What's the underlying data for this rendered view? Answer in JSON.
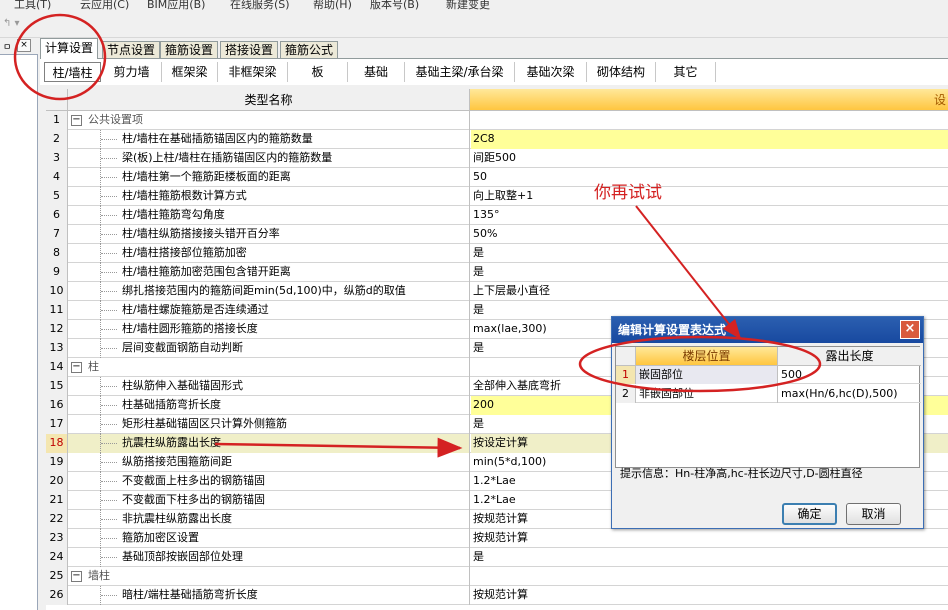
{
  "menu": {
    "items": [
      "工具(T)",
      "云应用(C)",
      "BIM应用(B)",
      "在线服务(S)",
      "帮助(H)",
      "版本号(B)",
      "新建变更"
    ]
  },
  "left_panel": {
    "pin": "📌",
    "close": "×"
  },
  "tabs_main": [
    {
      "label": "计算设置",
      "active": true
    },
    {
      "label": "节点设置",
      "active": false
    },
    {
      "label": "箍筋设置",
      "active": false
    },
    {
      "label": "搭接设置",
      "active": false
    },
    {
      "label": "箍筋公式",
      "active": false
    }
  ],
  "tabs_sub": [
    {
      "label": "柱/墙柱",
      "active": true
    },
    {
      "label": "剪力墙",
      "active": false
    },
    {
      "label": "框架梁",
      "active": false
    },
    {
      "label": "非框架梁",
      "active": false
    },
    {
      "label": "板",
      "active": false
    },
    {
      "label": "基础",
      "active": false
    },
    {
      "label": "基础主梁/承台梁",
      "active": false
    },
    {
      "label": "基础次梁",
      "active": false
    },
    {
      "label": "砌体结构",
      "active": false
    },
    {
      "label": "其它",
      "active": false
    }
  ],
  "grid": {
    "header_name": "类型名称",
    "header_value": "设",
    "rows": [
      {
        "n": "1",
        "name": "公共设置项",
        "value": "",
        "group": true,
        "expander": "−"
      },
      {
        "n": "2",
        "name": "柱/墙柱在基础插筋锚固区内的箍筋数量",
        "value": "2C8",
        "yellow": true
      },
      {
        "n": "3",
        "name": "梁(板)上柱/墙柱在插筋锚固区内的箍筋数量",
        "value": "间距500"
      },
      {
        "n": "4",
        "name": "柱/墙柱第一个箍筋距楼板面的距离",
        "value": "50"
      },
      {
        "n": "5",
        "name": "柱/墙柱箍筋根数计算方式",
        "value": "向上取整+1"
      },
      {
        "n": "6",
        "name": "柱/墙柱箍筋弯勾角度",
        "value": "135°"
      },
      {
        "n": "7",
        "name": "柱/墙柱纵筋搭接接头错开百分率",
        "value": "50%"
      },
      {
        "n": "8",
        "name": "柱/墙柱搭接部位箍筋加密",
        "value": "是"
      },
      {
        "n": "9",
        "name": "柱/墙柱箍筋加密范围包含错开距离",
        "value": "是"
      },
      {
        "n": "10",
        "name": "绑扎搭接范围内的箍筋间距min(5d,100)中，纵筋d的取值",
        "value": "上下层最小直径"
      },
      {
        "n": "11",
        "name": "柱/墙柱螺旋箍筋是否连续通过",
        "value": "是"
      },
      {
        "n": "12",
        "name": "柱/墙柱圆形箍筋的搭接长度",
        "value": "max(lae,300)"
      },
      {
        "n": "13",
        "name": "层间变截面钢筋自动判断",
        "value": "是"
      },
      {
        "n": "14",
        "name": "柱",
        "value": "",
        "group": true,
        "expander": "−"
      },
      {
        "n": "15",
        "name": "柱纵筋伸入基础锚固形式",
        "value": "全部伸入基底弯折"
      },
      {
        "n": "16",
        "name": "柱基础插筋弯折长度",
        "value": "200",
        "yellow": true
      },
      {
        "n": "17",
        "name": "矩形柱基础锚固区只计算外侧箍筋",
        "value": "是"
      },
      {
        "n": "18",
        "name": "抗震柱纵筋露出长度",
        "value": "按设定计算",
        "selected": true
      },
      {
        "n": "19",
        "name": "纵筋搭接范围箍筋间距",
        "value": "min(5*d,100)"
      },
      {
        "n": "20",
        "name": "不变截面上柱多出的钢筋锚固",
        "value": "1.2*Lae"
      },
      {
        "n": "21",
        "name": "不变截面下柱多出的钢筋锚固",
        "value": "1.2*Lae"
      },
      {
        "n": "22",
        "name": "非抗震柱纵筋露出长度",
        "value": "按规范计算"
      },
      {
        "n": "23",
        "name": "箍筋加密区设置",
        "value": "按规范计算"
      },
      {
        "n": "24",
        "name": "基础顶部按嵌固部位处理",
        "value": "是"
      },
      {
        "n": "25",
        "name": "墙柱",
        "value": "",
        "group": true,
        "expander": "−"
      },
      {
        "n": "26",
        "name": "暗柱/端柱基础插筋弯折长度",
        "value": "按规范计算"
      }
    ]
  },
  "dialog": {
    "title": "编辑计算设置表达式",
    "close": "×",
    "col1": "楼层位置",
    "col2": "露出长度",
    "rows": [
      {
        "n": "1",
        "pos": "嵌固部位",
        "len": "500"
      },
      {
        "n": "2",
        "pos": "非嵌固部位",
        "len": "max(Hn/6,hc(D),500)"
      }
    ],
    "tip": "提示信息：Hn-柱净高,hc-柱长边尺寸,D-圆柱直径",
    "ok": "确定",
    "cancel": "取消"
  },
  "annotation": {
    "text": "你再试试",
    "color": "#d42222"
  }
}
